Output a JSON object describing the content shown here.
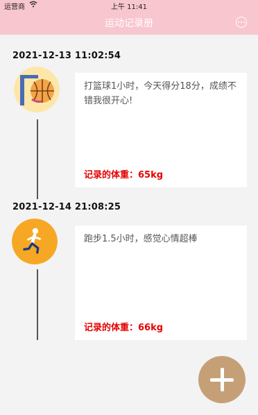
{
  "status_bar": {
    "carrier": "运营商",
    "time": "上午 11:41"
  },
  "nav": {
    "title": "运动记录册"
  },
  "records": [
    {
      "datetime": "2021-12-13 11:02:54",
      "icon": "basketball-icon",
      "note": "打篮球1小时，今天得分18分，成绩不错我很开心!",
      "weight_label": "记录的体重：",
      "weight_value": "65kg"
    },
    {
      "datetime": "2021-12-14 21:08:25",
      "icon": "running-icon",
      "note": "跑步1.5小时，感觉心情超棒",
      "weight_label": "记录的体重：",
      "weight_value": "66kg"
    }
  ],
  "colors": {
    "accent": "#f8c6cf",
    "fab": "#c5a077",
    "weight_text": "#e60000"
  },
  "fab_icon": "plus-icon"
}
